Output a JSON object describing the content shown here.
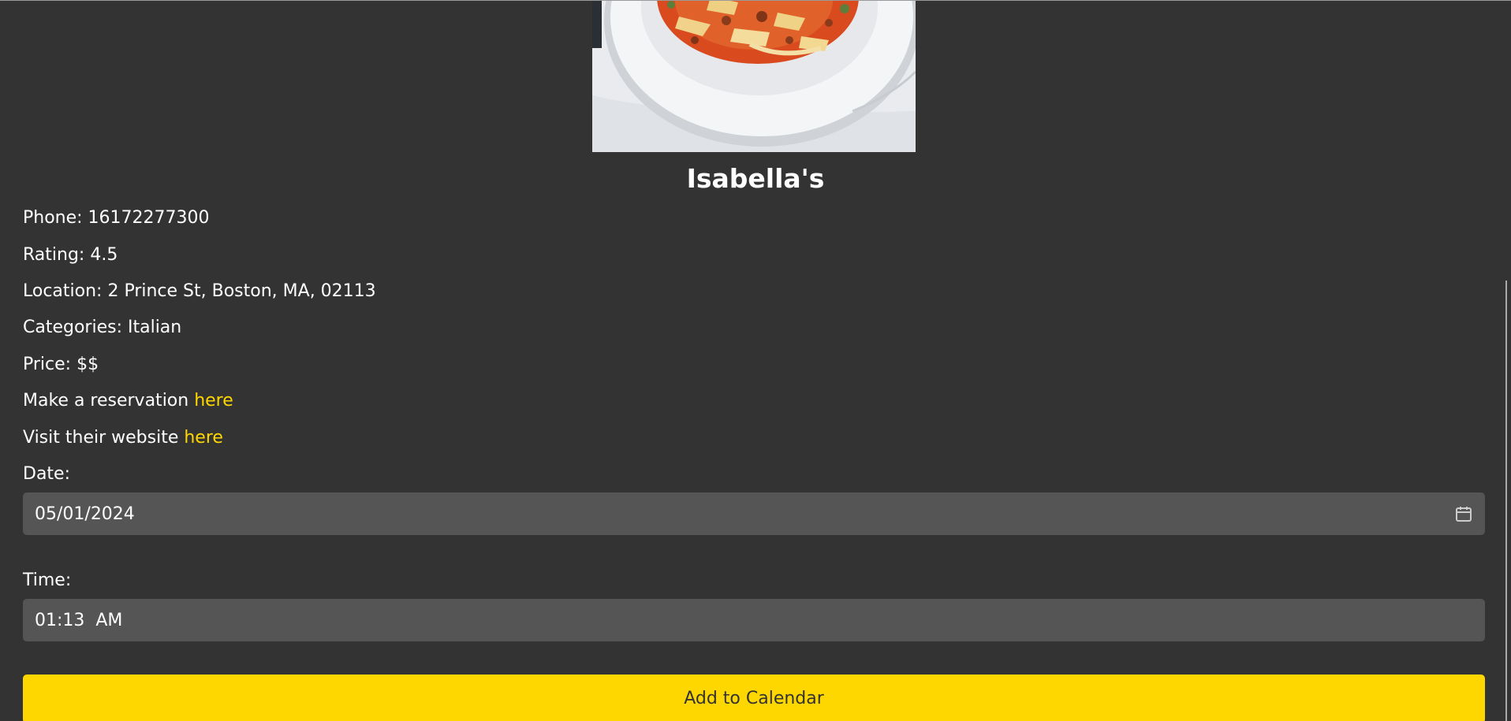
{
  "restaurant": {
    "name": "Isabella's",
    "image_icon": "pasta-dish-photo"
  },
  "details": {
    "phone": "Phone: 16172277300",
    "rating": "Rating: 4.5",
    "location": "Location: 2 Prince St, Boston, MA, 02113",
    "categories": "Categories: Italian",
    "price": "Price: $$",
    "reservation_prefix": "Make a reservation ",
    "reservation_link": "here",
    "website_prefix": "Visit their website ",
    "website_link": "here"
  },
  "form": {
    "date_label": "Date:",
    "date_value": "05/01/2024",
    "time_label": "Time:",
    "time_value": "01:13  AM",
    "submit_label": "Add to Calendar"
  },
  "colors": {
    "background": "#333333",
    "accent": "#ffd700",
    "field": "#555555"
  }
}
